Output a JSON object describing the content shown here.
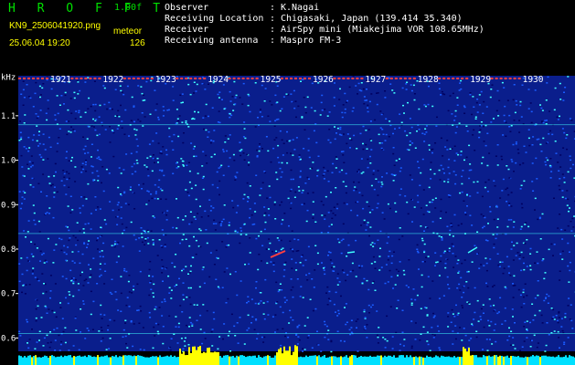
{
  "header": {
    "app_title": "H R O F F T",
    "version": "1.00f",
    "filename": "KN9_2506041920.png",
    "meteor_label": "meteor",
    "datetime": "25.06.04 19:20",
    "meteor_count": "126",
    "info": [
      {
        "key": "Observer",
        "sep": ":",
        "value": "K.Nagai"
      },
      {
        "key": "Receiving Location",
        "sep": ":",
        "value": "Chigasaki, Japan (139.414 35.340)"
      },
      {
        "key": "Receiver",
        "sep": ":",
        "value": "AirSpy mini (Miakejima VOR 108.65MHz)"
      },
      {
        "key": "Receiving antenna",
        "sep": ":",
        "value": "Maspro FM-3"
      }
    ]
  },
  "spectrogram": {
    "unit_label": "kHz",
    "freq_ticks": [
      "1.1",
      "1.0",
      "0.9",
      "0.8",
      "0.7",
      "0.6"
    ],
    "freq_tick_values": [
      1.1,
      1.0,
      0.9,
      0.8,
      0.7,
      0.6
    ],
    "freq_range": [
      0.57,
      1.19
    ],
    "time_labels": [
      "1921",
      "1922",
      "1923",
      "1924",
      "1925",
      "1926",
      "1927",
      "1928",
      "1929",
      "1930"
    ],
    "colors": {
      "background": "#0a1e8c",
      "noise_dark": "#000060",
      "noise_light": "#1a5cff",
      "noise_cyan": "#40ffff",
      "signal": "#ff4040",
      "power_bar_low": "#00e0ff",
      "power_bar_high": "#ffff00"
    }
  }
}
